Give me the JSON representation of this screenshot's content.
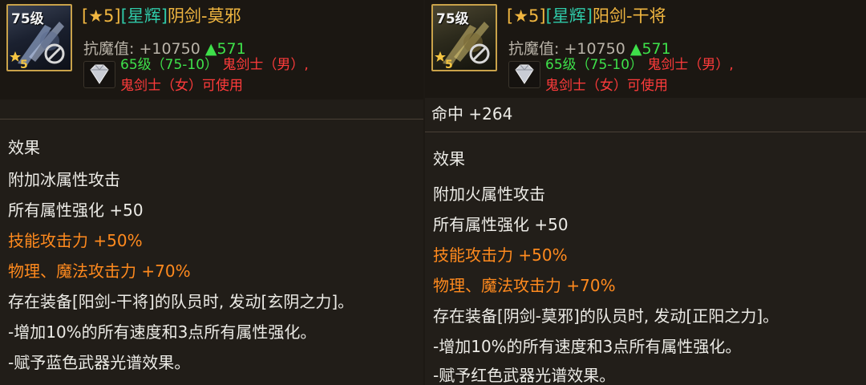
{
  "left": {
    "level": "75级",
    "name_star": "★5",
    "name_tag": "星辉",
    "name": "阴剑-莫邪",
    "stat_label": "抗魔值: +10750",
    "stat_up": "▲571",
    "req_level": "65级（75-10）",
    "req_class_1": "鬼剑士（男）,",
    "req_class_2": "鬼剑士（女）可使用",
    "effects_title": "效果",
    "lines": [
      "附加冰属性攻击",
      "所有属性强化 +50",
      "技能攻击力 +50%",
      "物理、魔法攻击力 +70%",
      "存在装备[阳剑-干将]的队员时, 发动[玄阴之力]。",
      "-增加10%的所有速度和3点所有属性强化。",
      "-赋予蓝色武器光谱效果。"
    ]
  },
  "right": {
    "level": "75级",
    "name_star": "★5",
    "name_tag": "星辉",
    "name": "阳剑-干将",
    "stat_label": "抗魔值: +10750",
    "stat_up": "▲571",
    "req_level": "65级（75-10）",
    "req_class_1": "鬼剑士（男）,",
    "req_class_2": "鬼剑士（女）可使用",
    "hit_line": "命中 +264",
    "effects_title": "效果",
    "lines": [
      "附加火属性攻击",
      "所有属性强化 +50",
      "技能攻击力 +50%",
      "物理、魔法攻击力 +70%",
      "存在装备[阴剑-莫邪]的队员时, 发动[正阳之力]。",
      "-增加10%的所有速度和3点所有属性强化。",
      "-赋予红色武器光谱效果。"
    ]
  },
  "colors": {
    "gold": "#f0b640",
    "teal": "#2fc9a8",
    "green": "#3ee04a",
    "red": "#ff3b3b",
    "orange": "#ff8a1e"
  },
  "icons": [
    "star-rank-icon",
    "ban-icon",
    "diamond-gem-icon"
  ]
}
